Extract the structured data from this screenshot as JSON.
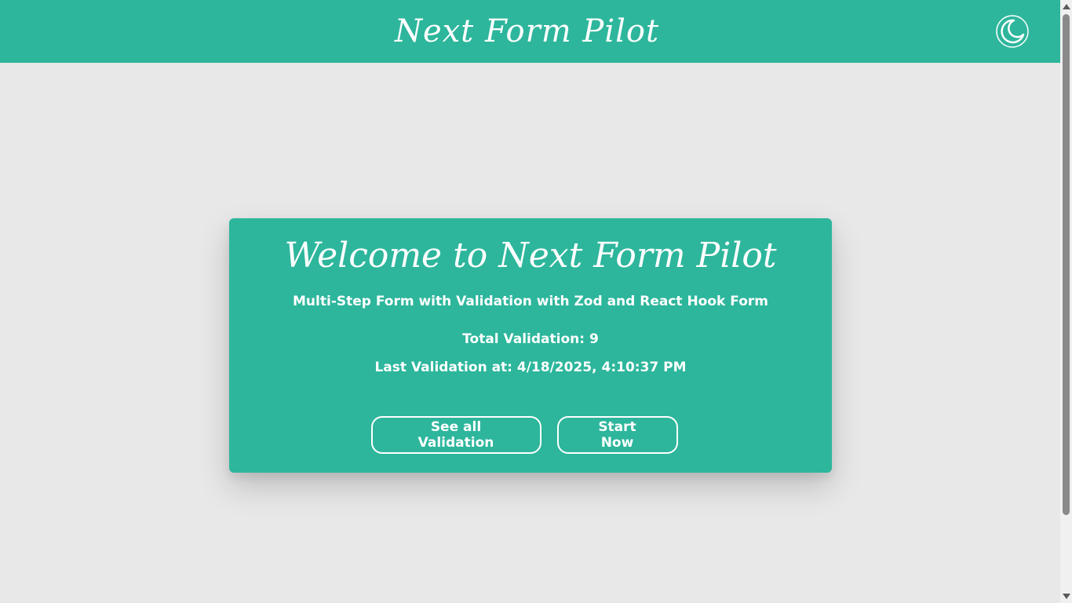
{
  "header": {
    "brand": "Next Form Pilot",
    "theme_toggle_icon": "moon-icon"
  },
  "card": {
    "title": "Welcome to Next Form Pilot",
    "subtitle": "Multi-Step Form with Validation with Zod and React Hook Form",
    "total_validation": "Total Validation: 9",
    "last_validation": "Last Validation at: 4/18/2025, 4:10:37 PM",
    "buttons": {
      "see_all": "See all Validation",
      "start": "Start Now"
    }
  },
  "colors": {
    "accent": "#2db69c",
    "background": "#e8e8e8",
    "text_on_accent": "#ffffff"
  }
}
